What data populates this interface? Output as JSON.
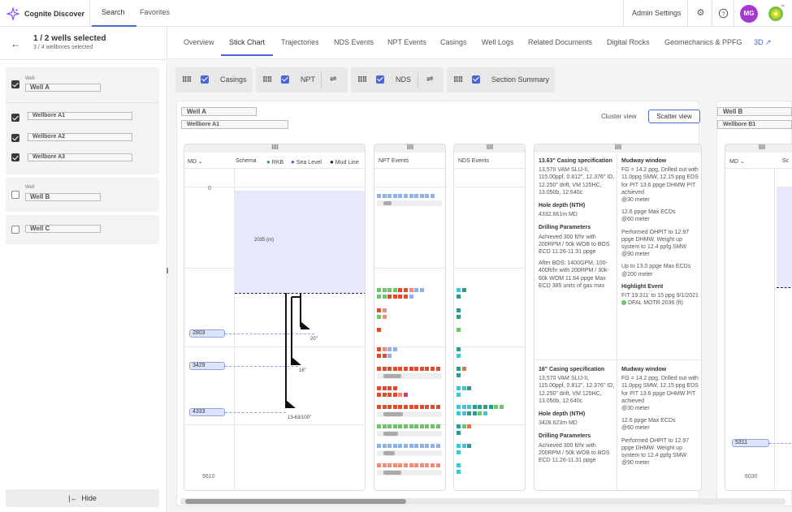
{
  "app": {
    "title": "Cognite Discover"
  },
  "nav": {
    "search": "Search",
    "favorites": "Favorites",
    "admin": "Admin Settings",
    "avatar": "MG"
  },
  "sidebar": {
    "selection_title": "1 / 2 wells selected",
    "selection_sub": "3 / 4 wellbores selected",
    "well_label": "Well",
    "wells": [
      {
        "name": "Well A",
        "checked": true,
        "wellbores": [
          {
            "name": "Wellbore A1",
            "checked": true
          },
          {
            "name": "Wellbore A2",
            "checked": true
          },
          {
            "name": "Wellbore A3",
            "checked": true
          }
        ]
      },
      {
        "name": "Well B",
        "checked": false
      },
      {
        "name": "Well C",
        "checked": false
      }
    ],
    "hide_label": "Hide"
  },
  "tabs": [
    "Overview",
    "Stick Chart",
    "Trajectories",
    "NDS Events",
    "NPT Events",
    "Casings",
    "Well Logs",
    "Related Documents",
    "Digital Rocks",
    "Geomechanics & PPFG",
    "3D"
  ],
  "active_tab": "Stick Chart",
  "toolbar": {
    "casings": "Casings",
    "npt": "NPT",
    "nds": "NDS",
    "section_summary": "Section Summary"
  },
  "well_a": {
    "well": "Well A",
    "wellbore": "Wellbore A1",
    "cluster_view": "Cluster view",
    "scatter_view": "Scatter view",
    "columns": {
      "md": "MD",
      "schema": "Schema",
      "rkb": "RKB",
      "sea_level": "Sea Level",
      "mud_line": "Mud Line",
      "npt_events": "NPT Events",
      "nds_events": "NDS Events"
    },
    "depth_top": "0",
    "depth_bottom": "5610",
    "water_depth": "2035 (m)",
    "depth_tags": [
      "2803",
      "3429",
      "4333"
    ],
    "casing_labels": [
      "20\"",
      "16\"",
      "13-63/100\""
    ],
    "summary": {
      "s1": {
        "casing_title": "13.63\" Casing specification",
        "casing_text": "13,570 VAM SLIJ-II, 115.00ppf, 0.812\", 12.376\" ID, 12.250\" drift, VM 125HC, 13.050b, 12.640c",
        "hole_title": "Hole depth (NTH)",
        "hole_text": "4332.661m MD",
        "drill_title": "Drilling Parameters",
        "drill_text1": "Achieved 300 ft/hr with 200RPM / 50k WOB to BOS ECD 11.26-11.31 ppge",
        "drill_text2": "After BOS: 1400GPM, 100-400ft/hr with 200RPM / 30k-60k WOM 11.64 ppge Max ECD 385 units of gas max",
        "mud_title": "Mudway window",
        "mud_text": "FG = 14.2 ppg, Drilled out with 11.0ppg SMW, 12.15 ppg EDS for PIT 13.6 ppge DHMW PIT achieved",
        "mud_at1": "@30 meter",
        "ecd_text": "12.6 ppge Max ECDs",
        "ecd_at": "@60 meter",
        "ohpit_text": "Performed OHPIT to 12.97 ppge DHMW. Weight up system to 12.4 ppfg SMW",
        "ohpit_at": "@90 meter",
        "up_text": "Up to 13.0 ppge Max ECDs",
        "up_at": "@200 meter",
        "highlight_title": "Highlight Event",
        "highlight_text": "FIT 19.311' to 15 ppg 9/1/2021",
        "highlight_tag": "DFAL MOTR 2036 (ft)"
      },
      "s2": {
        "casing_title": "16\" Casing specification",
        "casing_text": "13,570 VAM SLIJ-II, 115.00ppf, 0.812\", 12.376\" ID, 12.250\" drift, VM 125HC, 13.050b, 12.640c",
        "hole_title": "Hole depth (NTH)",
        "hole_text": "3428.623m MD",
        "drill_title": "Drilling Parameters",
        "drill_text1": "Achieved 300 ft/hr with 200RPM / 50k WOB to BOS ECD 11.26-11.31 ppge",
        "mud_title": "Mudway window",
        "mud_text": "FG = 14.2 ppg, Drilled out with 11.0ppg SMW, 12.15 ppg EDS for PIT 13.6 ppge DHMW PIT achieved",
        "mud_at1": "@30 meter",
        "ecd_text": "12.6 ppge Max ECDs",
        "ecd_at": "@60 meter",
        "ohpit_text": "Performed OHPIT to 12.97 ppge DHMW. Weight up system to 12.4 ppfg SMW",
        "ohpit_at": "@90 meter"
      }
    }
  },
  "well_b": {
    "well": "Well B",
    "wellbore": "Wellbore B1",
    "md": "MD",
    "schema_abbrev": "Sc",
    "depth_tag": "5311",
    "depth_bottom": "6030"
  },
  "colors": {
    "accent": "#4a67d6",
    "water": "#e6e9fb",
    "npt_red": "#e04b2e",
    "npt_blue": "#8fb0e8",
    "npt_green": "#6cc56b",
    "nds_teal": "#2a9d8f",
    "nds_cyan": "#3cc6d8"
  }
}
